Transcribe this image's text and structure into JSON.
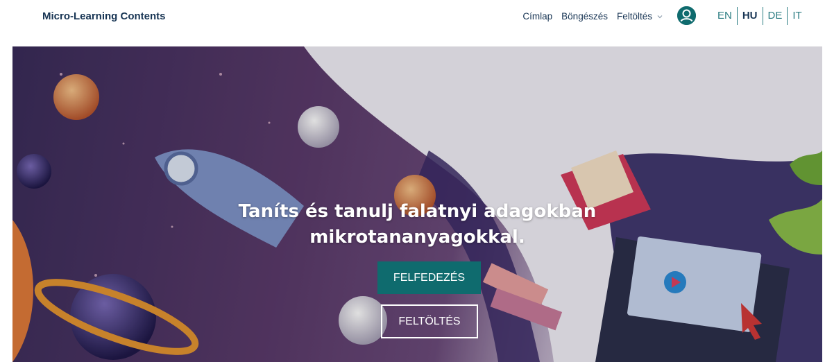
{
  "brand": "Micro-Learning Contents",
  "nav": {
    "home": "Címlap",
    "browse": "Böngészés",
    "upload": "Feltöltés"
  },
  "icons": {
    "profile": "user-icon",
    "dropdown": "chevron-down-icon"
  },
  "languages": [
    {
      "code": "EN",
      "active": false
    },
    {
      "code": "HU",
      "active": true
    },
    {
      "code": "DE",
      "active": false
    },
    {
      "code": "IT",
      "active": false
    }
  ],
  "hero": {
    "title_line1": "Taníts és tanulj falatnyi adagokban",
    "title_line2": "mikrotananyagokkal.",
    "explore_label": "FELFEDEZÉS",
    "upload_label": "FELTÖLTÉS"
  },
  "colors": {
    "accent": "#0f6b6e",
    "text": "#183554",
    "lang": "#2c7d83"
  }
}
